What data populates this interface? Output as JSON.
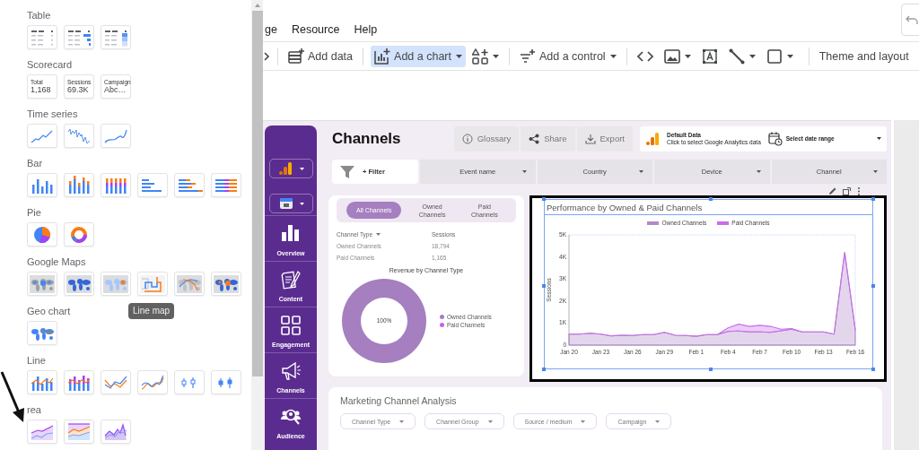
{
  "chart_panel": {
    "sections": [
      {
        "title": "Table",
        "items": [
          {
            "kind": "table"
          },
          {
            "kind": "table-bars"
          },
          {
            "kind": "table-heatmap"
          }
        ]
      },
      {
        "title": "Scorecard",
        "items": [
          {
            "kind": "scorecard",
            "label": "Total",
            "value": "1,168"
          },
          {
            "kind": "scorecard",
            "label": "Sessions",
            "value": "69.3K"
          },
          {
            "kind": "scorecard",
            "label": "Campaign",
            "value": "Abc…"
          }
        ]
      },
      {
        "title": "Time series",
        "items": [
          {
            "kind": "line"
          },
          {
            "kind": "sparkline"
          },
          {
            "kind": "smooth-line"
          }
        ]
      },
      {
        "title": "Bar",
        "items": [
          {
            "kind": "column"
          },
          {
            "kind": "stacked-column"
          },
          {
            "kind": "full-stacked-column"
          },
          {
            "kind": "bar"
          },
          {
            "kind": "stacked-bar"
          },
          {
            "kind": "full-stacked-bar"
          }
        ]
      },
      {
        "title": "Pie",
        "items": [
          {
            "kind": "pie"
          },
          {
            "kind": "donut"
          }
        ]
      },
      {
        "title": "Google Maps",
        "items": [
          {
            "kind": "bubble-map"
          },
          {
            "kind": "filled-map"
          },
          {
            "kind": "heat-map"
          },
          {
            "kind": "line-map",
            "tooltip": "Line map"
          },
          {
            "kind": "route-map"
          },
          {
            "kind": "combo-map"
          }
        ]
      },
      {
        "title": "Geo chart",
        "items": [
          {
            "kind": "geo"
          }
        ]
      },
      {
        "title": "Line",
        "items": [
          {
            "kind": "combo"
          },
          {
            "kind": "stacked-combo"
          },
          {
            "kind": "two-line"
          },
          {
            "kind": "two-smooth-line"
          },
          {
            "kind": "candlestick"
          },
          {
            "kind": "filled-candlestick"
          }
        ]
      },
      {
        "title": "rea",
        "items": [
          {
            "kind": "area"
          },
          {
            "kind": "stacked-area"
          },
          {
            "kind": "peak-area"
          }
        ]
      }
    ]
  },
  "menu": [
    "ge",
    "Resource",
    "Help"
  ],
  "toolbar": [
    {
      "kind": "scroll",
      "dropdown": false,
      "selected": false
    },
    {
      "kind": "separator"
    },
    {
      "kind": "add-data",
      "label": "Add data",
      "dropdown": false,
      "selected": false
    },
    {
      "kind": "separator"
    },
    {
      "kind": "add-chart",
      "label": "Add a chart",
      "dropdown": true,
      "selected": true
    },
    {
      "kind": "components",
      "dropdown": true,
      "selected": false
    },
    {
      "kind": "separator"
    },
    {
      "kind": "add-control",
      "label": "Add a control",
      "dropdown": true,
      "selected": false
    },
    {
      "kind": "separator"
    },
    {
      "kind": "embed",
      "dropdown": false,
      "selected": false
    },
    {
      "kind": "image",
      "dropdown": true,
      "selected": false
    },
    {
      "kind": "text",
      "dropdown": false,
      "selected": false
    },
    {
      "kind": "line",
      "dropdown": true,
      "selected": false
    },
    {
      "kind": "shape",
      "dropdown": true,
      "selected": false
    },
    {
      "kind": "separator"
    },
    {
      "kind": "theme",
      "label": "Theme and layout",
      "dropdown": false,
      "selected": false
    }
  ],
  "report": {
    "sidebar": {
      "selectors": [
        {
          "kind": "analytics"
        },
        {
          "kind": "calendar"
        }
      ],
      "nav": [
        {
          "kind": "overview",
          "label": "Overview"
        },
        {
          "kind": "content",
          "label": "Content"
        },
        {
          "kind": "engagement",
          "label": "Engagement"
        },
        {
          "kind": "channels",
          "label": "Channels"
        },
        {
          "kind": "audience",
          "label": "Audience"
        }
      ]
    },
    "title": "Channels",
    "actions": [
      {
        "kind": "info",
        "label": "Glossary"
      },
      {
        "kind": "share",
        "label": "Share"
      },
      {
        "kind": "export",
        "label": "Export"
      }
    ],
    "data_source": {
      "name": "Default Data",
      "hint": "Click to select Google Analytics data"
    },
    "date_range": {
      "label": "Select date range"
    },
    "filter": {
      "label": "+ Filter"
    },
    "filters": [
      "Event name",
      "Country",
      "Device",
      "Channel"
    ],
    "channel_tabs": [
      {
        "label": "All Channels",
        "selected": true
      },
      {
        "label": "Owned Channels",
        "selected": false
      },
      {
        "label": "Paid Channels",
        "selected": false
      }
    ],
    "channel_table": {
      "columns": [
        "Channel Type",
        "Sessions"
      ],
      "rows": [
        [
          "Owned Channels",
          "18,794"
        ],
        [
          "Paid Channels",
          "1,165"
        ]
      ]
    },
    "revenue_chart": {
      "chart_data": {
        "type": "donut",
        "title": "Revenue by Channel Type",
        "categories": [
          "Owned Channels",
          "Paid Channels"
        ],
        "colors": [
          "#a57fc0",
          "#c95ef0"
        ],
        "values": [
          100,
          0
        ],
        "value_labels": [
          "100%",
          null
        ]
      }
    },
    "performance_chart": {
      "chart_data": {
        "type": "area",
        "title": "Performance by Owned & Paid Channels",
        "ylabel": "Sessions",
        "stacked": true,
        "legend": "top",
        "categories": [
          "Jan 20",
          null,
          null,
          "Jan 23",
          null,
          null,
          "Jan 26",
          null,
          null,
          "Jan 29",
          null,
          null,
          "Feb 1",
          null,
          null,
          "Feb 4",
          null,
          null,
          "Feb 7",
          null,
          null,
          "Feb 10",
          null,
          null,
          "Feb 13",
          null,
          null,
          "Feb 16"
        ],
        "series": [
          {
            "name": "Owned Channels",
            "color": "#b08ac8",
            "values": [
              500,
              500,
              540,
              500,
              420,
              450,
              440,
              480,
              480,
              580,
              450,
              440,
              400,
              480,
              480,
              620,
              640,
              600,
              600,
              580,
              650,
              720,
              600,
              600,
              600,
              500,
              4200,
              700
            ]
          },
          {
            "name": "Paid Channels",
            "color": "#c86ee8",
            "values": [
              0,
              0,
              0,
              0,
              0,
              0,
              0,
              0,
              0,
              0,
              0,
              0,
              0,
              0,
              0,
              160,
              310,
              250,
              300,
              270,
              70,
              30,
              0,
              0,
              0,
              0,
              0,
              0
            ]
          }
        ],
        "ylim": [
          0,
          5000
        ],
        "yticks": [
          {
            "value": 0,
            "label": "0"
          },
          {
            "value": 1000,
            "label": "1K"
          },
          {
            "value": 2000,
            "label": "2K"
          },
          {
            "value": 3000,
            "label": "3K"
          },
          {
            "value": 4000,
            "label": "4K"
          },
          {
            "value": 5000,
            "label": "5K"
          }
        ]
      }
    },
    "analysis": {
      "title": "Marketing Channel Analysis",
      "filters": [
        "Channel Type",
        "Channel Group",
        "Source / medium",
        "Campaign"
      ]
    }
  }
}
